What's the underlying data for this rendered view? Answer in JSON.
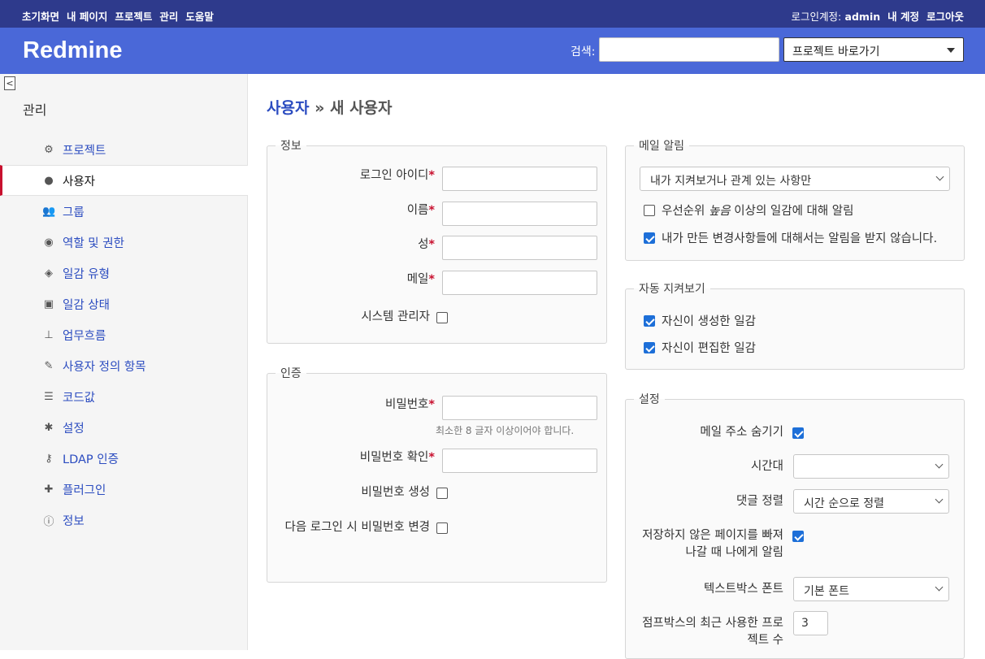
{
  "topbar": {
    "left": [
      "초기화면",
      "내 페이지",
      "프로젝트",
      "관리",
      "도움말"
    ],
    "login_label": "로그인계정:",
    "user": "admin",
    "account": "내 계정",
    "logout": "로그아웃"
  },
  "header": {
    "logo": "Redmine",
    "search_label": "검색:",
    "search_value": "",
    "jump": "프로젝트 바로가기"
  },
  "sidebar": {
    "collapse": "<",
    "title": "관리",
    "items": [
      {
        "label": "프로젝트",
        "icon": "projects-icon",
        "glyph": "⚙"
      },
      {
        "label": "사용자",
        "icon": "user-icon",
        "glyph": "●"
      },
      {
        "label": "그룹",
        "icon": "group-icon",
        "glyph": "👥"
      },
      {
        "label": "역할 및 권한",
        "icon": "eye-icon",
        "glyph": "◉"
      },
      {
        "label": "일감 유형",
        "icon": "tag-icon",
        "glyph": "◈"
      },
      {
        "label": "일감 상태",
        "icon": "edit-square-icon",
        "glyph": "▣"
      },
      {
        "label": "업무흐름",
        "icon": "workflow-icon",
        "glyph": "⊥"
      },
      {
        "label": "사용자 정의 항목",
        "icon": "pencil-square-icon",
        "glyph": "✎"
      },
      {
        "label": "코드값",
        "icon": "list-icon",
        "glyph": "☰"
      },
      {
        "label": "설정",
        "icon": "gear-icon",
        "glyph": "✱"
      },
      {
        "label": "LDAP 인증",
        "icon": "key-icon",
        "glyph": "⚷"
      },
      {
        "label": "플러그인",
        "icon": "puzzle-icon",
        "glyph": "✚"
      },
      {
        "label": "정보",
        "icon": "info-icon",
        "glyph": "ⓘ"
      }
    ]
  },
  "page": {
    "crumb_link": "사용자",
    "crumb_sep": " » ",
    "crumb_rest": "새 사용자"
  },
  "info": {
    "legend": "정보",
    "login": "로그인 아이디",
    "firstname": "이름",
    "lastname": "성",
    "mail": "메일",
    "admin": "시스템 관리자",
    "star": "*"
  },
  "auth": {
    "legend": "인증",
    "password": "비밀번호",
    "password_hint": "최소한 8 글자 이상이어야 합니다.",
    "confirm": "비밀번호 확인",
    "generate": "비밀번호 생성",
    "must_change": "다음 로그인 시 비밀번호 변경"
  },
  "mail_notif": {
    "legend": "메일 알림",
    "select": "내가 지켜보거나 관계 있는 사항만",
    "high_prefix": "우선순위 ",
    "high_em": "높음",
    "high_suffix": " 이상의 일감에 대해 알림",
    "no_self": "내가 만든 변경사항들에 대해서는 알림을 받지 않습니다."
  },
  "autowatch": {
    "legend": "자동 지켜보기",
    "created": "자신이 생성한 일감",
    "edited": "자신이 편집한 일감"
  },
  "prefs": {
    "legend": "설정",
    "hide_mail": "메일 주소 숨기기",
    "timezone": "시간대",
    "timezone_value": "",
    "comments": "댓글 정렬",
    "comments_value": "시간 순으로 정렬",
    "warn_line1": "저장하지 않은 페이지를 빠져",
    "warn_line2": "나갈 때 나에게 알림",
    "font": "텍스트박스 폰트",
    "font_value": "기본 폰트",
    "recent_line1": "점프박스의 최근 사용한 프로",
    "recent_line2": "젝트 수",
    "recent_value": "3"
  }
}
